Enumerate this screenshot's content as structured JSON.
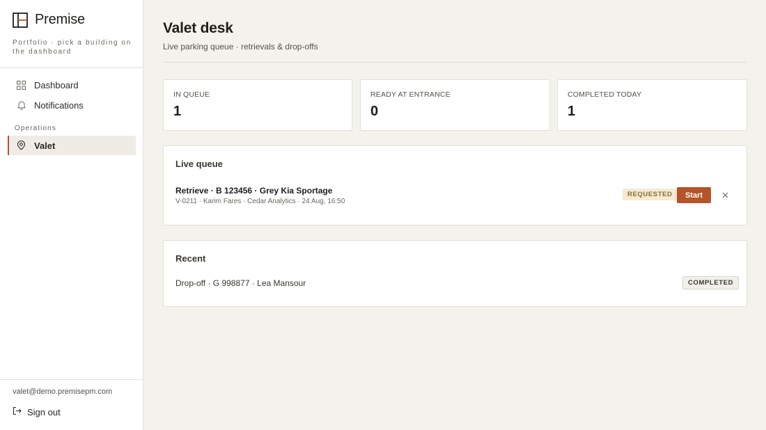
{
  "brand": {
    "name": "Premise",
    "subtitle": "Portfolio · pick a building on the dashboard",
    "icon": "layout-panel-icon"
  },
  "sidebar": {
    "items": [
      {
        "label": "Dashboard",
        "icon": "grid-icon"
      },
      {
        "label": "Notifications",
        "icon": "bell-icon"
      }
    ],
    "section_label": "Operations",
    "active_item": {
      "label": "Valet",
      "icon": "map-pin-icon"
    },
    "user_email": "valet@demo.premisepm.com",
    "signout_label": "Sign out",
    "signout_icon": "sign-out-icon"
  },
  "header": {
    "title": "Valet desk",
    "subtitle": "Live parking queue · retrievals & drop-offs"
  },
  "stats": [
    {
      "label": "IN QUEUE",
      "value": "1"
    },
    {
      "label": "READY AT ENTRANCE",
      "value": "0"
    },
    {
      "label": "COMPLETED TODAY",
      "value": "1"
    }
  ],
  "queue": {
    "title": "Live queue",
    "items": [
      {
        "title": "Retrieve · B  123456 · Grey Kia Sportage",
        "meta": "V-0211 · Karim Fares · Cedar Analytics · 24 Aug, 16:50",
        "status": "REQUESTED",
        "action_label": "Start",
        "dismiss_icon": "close-icon"
      }
    ]
  },
  "recent": {
    "title": "Recent",
    "items": [
      {
        "text": "Drop-off · G 998877 · Lea Mansour",
        "status": "COMPLETED"
      }
    ]
  },
  "colors": {
    "accent": "#b5532a",
    "background": "#f4f2ed",
    "surface": "#ffffff",
    "requested_badge_bg": "#f6ead3",
    "requested_badge_text": "#8a6a2e"
  }
}
